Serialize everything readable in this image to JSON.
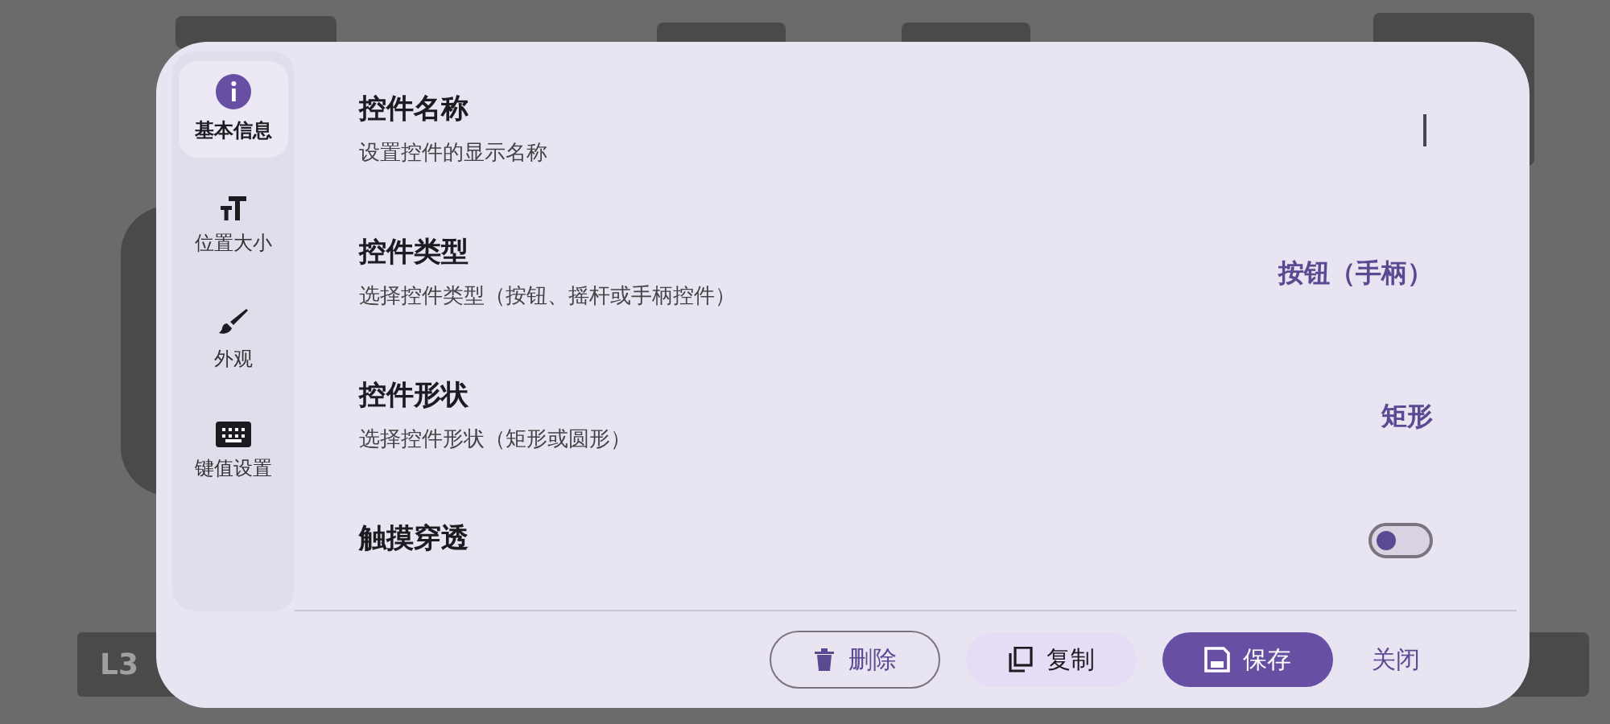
{
  "background": {
    "label": "L3"
  },
  "sidebar": {
    "items": [
      {
        "label": "基本信息",
        "selected": true
      },
      {
        "label": "位置大小",
        "selected": false
      },
      {
        "label": "外观",
        "selected": false
      },
      {
        "label": "键值设置",
        "selected": false
      }
    ]
  },
  "settings": [
    {
      "kind": "text",
      "title": "控件名称",
      "subtitle": "设置控件的显示名称"
    },
    {
      "kind": "choice",
      "title": "控件类型",
      "subtitle": "选择控件类型（按钮、摇杆或手柄控件）",
      "value": "按钮（手柄）"
    },
    {
      "kind": "choice",
      "title": "控件形状",
      "subtitle": "选择控件形状（矩形或圆形）",
      "value": "矩形"
    },
    {
      "kind": "switch",
      "title": "触摸穿透",
      "on": false
    }
  ],
  "buttons": [
    {
      "kind": "outline",
      "label": "删除"
    },
    {
      "kind": "tonal",
      "label": "复制"
    },
    {
      "kind": "filled",
      "label": "保存"
    },
    {
      "kind": "text",
      "label": "关闭"
    }
  ]
}
